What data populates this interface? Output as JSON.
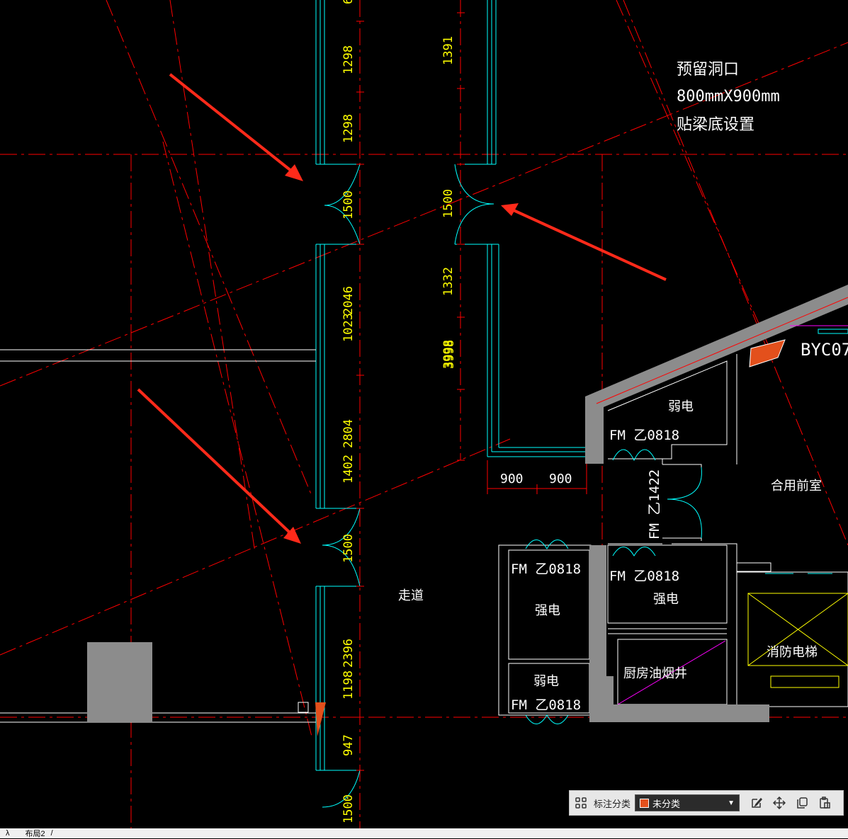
{
  "drawing": {
    "dimensions_left": [
      "6",
      "1298",
      "1298",
      "1500",
      "1023",
      "2046",
      "1402",
      "2804",
      "1500",
      "1198",
      "2396",
      "947",
      "1500"
    ],
    "dimensions_mid": [
      "1391",
      "1500",
      "1332",
      "3998",
      "3998"
    ],
    "dimensions_bottom": [
      "900",
      "900"
    ],
    "note_lines": [
      "预留洞口",
      "800mmX900mm",
      "贴梁底设置"
    ],
    "labels": {
      "byc": "BYC07",
      "weak_room_top": "弱电",
      "fm_top": "FM 乙0818",
      "shared_lobby": "合用前室",
      "door_vertical": "FM 乙1422",
      "fm_left_top": "FM 乙0818",
      "strong_left": "强电",
      "fm_right_mid": "FM 乙0818",
      "strong_right": "强电",
      "weak_left": "弱电",
      "fm_left_bottom": "FM 乙0818",
      "kitchen_shaft": "厨房油烟井",
      "fire_elevator": "消防电梯",
      "corridor": "走道"
    },
    "colors": {
      "axis": "#ff0000",
      "wall": "#00ffff",
      "wall_fill": "#8c8c8c",
      "dimension_text": "#ffff00",
      "label_text": "#ffffff",
      "arrow": "#ff2a1a",
      "magenta": "#ff00ff"
    }
  },
  "toolbar": {
    "menu_icon": "grid-icon",
    "category_label": "标注分类",
    "category_value": "未分类",
    "category_color": "#e3501c",
    "edit_icon": "edit-icon",
    "move_icon": "move-icon",
    "copy_icon": "copy-icon",
    "paste_icon": "paste-icon"
  },
  "tabs": {
    "prev": "λ",
    "layout": "布局2",
    "sep": "/"
  }
}
